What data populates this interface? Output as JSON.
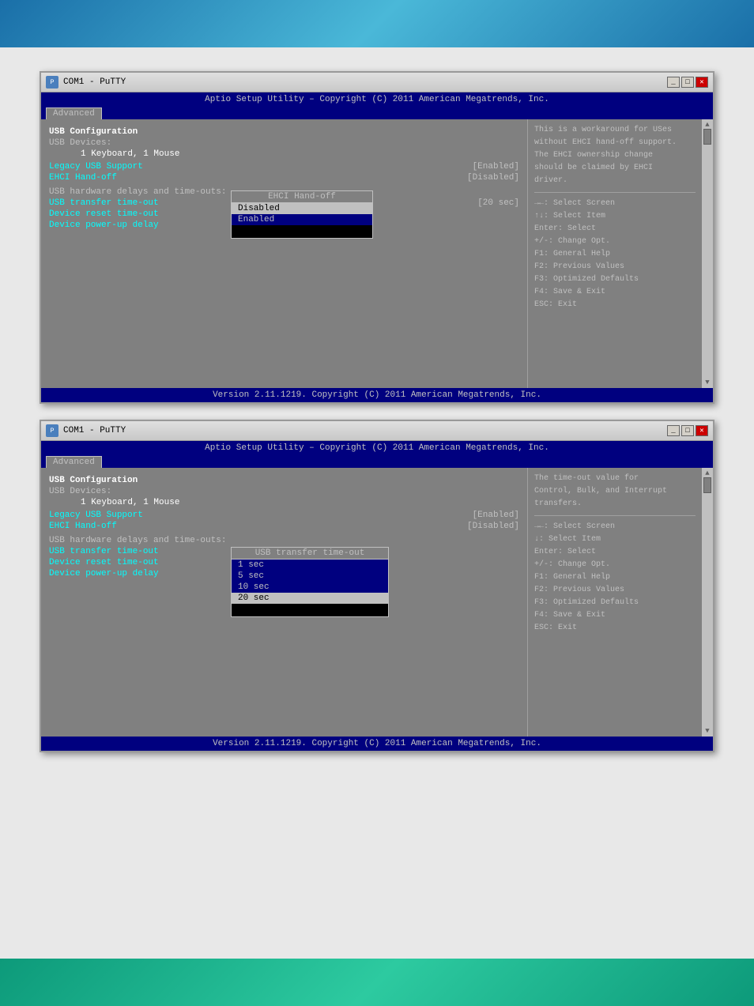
{
  "top_bar": {
    "color": "#1a6fa8"
  },
  "bottom_bar": {
    "color": "#0d9a7a"
  },
  "window1": {
    "title": "COM1 - PuTTY",
    "header": "Aptio Setup Utility – Copyright (C) 2011 American Megatrends, Inc.",
    "tab": "Advanced",
    "section_title": "USB Configuration",
    "usb_devices_label": "USB Devices:",
    "usb_devices_value": "1 Keyboard, 1 Mouse",
    "legacy_usb_label": "Legacy USB Support",
    "legacy_usb_value": "[Enabled]",
    "ehci_label": "EHCI Hand-off",
    "ehci_value": "[Disabled]",
    "hardware_delays_label": "USB hardware delays and time-outs:",
    "usb_transfer_label": "USB transfer time-out",
    "usb_transfer_value": "[20 sec]",
    "device_reset_label": "Device reset time-out",
    "device_power_label": "Device power-up delay",
    "popup_title": "EHCI Hand-off",
    "popup_items": [
      "Disabled",
      "Enabled"
    ],
    "popup_selected": "Disabled",
    "right_help": [
      "This is a workaround for USes",
      "without EHCI hand-off support.",
      "The EHCI ownership change",
      "should be claimed by EHCI",
      "driver."
    ],
    "key_help": [
      "→←: Select Screen",
      "↑↓: Select Item",
      "Enter: Select",
      "+/-: Change Opt.",
      "F1: General Help",
      "F2: Previous Values",
      "F3: Optimized Defaults",
      "F4: Save & Exit",
      "ESC: Exit"
    ],
    "footer": "Version 2.11.1219. Copyright (C) 2011 American Megatrends, Inc."
  },
  "window2": {
    "title": "COM1 - PuTTY",
    "header": "Aptio Setup Utility – Copyright (C) 2011 American Megatrends, Inc.",
    "tab": "Advanced",
    "section_title": "USB Configuration",
    "usb_devices_label": "USB Devices:",
    "usb_devices_value": "1 Keyboard, 1 Mouse",
    "legacy_usb_label": "Legacy USB Support",
    "legacy_usb_value": "[Enabled]",
    "ehci_label": "EHCI Hand-off",
    "ehci_value": "[Disabled]",
    "hardware_delays_label": "USB hardware delays and time-outs:",
    "usb_transfer_label": "USB transfer time-out",
    "device_reset_label": "Device reset time-out",
    "device_power_label": "Device power-up delay",
    "popup_title": "USB transfer time-out",
    "popup_items": [
      "1 sec",
      "5 sec",
      "10 sec",
      "20 sec"
    ],
    "popup_selected": "20 sec",
    "right_help": [
      "The time-out value for",
      "Control, Bulk, and Interrupt",
      "transfers."
    ],
    "key_help": [
      "→←: Select Screen",
      "↓: Select Item",
      "Enter: Select",
      "+/-: Change Opt.",
      "F1: General Help",
      "F2: Previous Values",
      "F3: Optimized Defaults",
      "F4: Save & Exit",
      "ESC: Exit"
    ],
    "footer": "Version 2.11.1219. Copyright (C) 2011 American Megatrends, Inc."
  }
}
